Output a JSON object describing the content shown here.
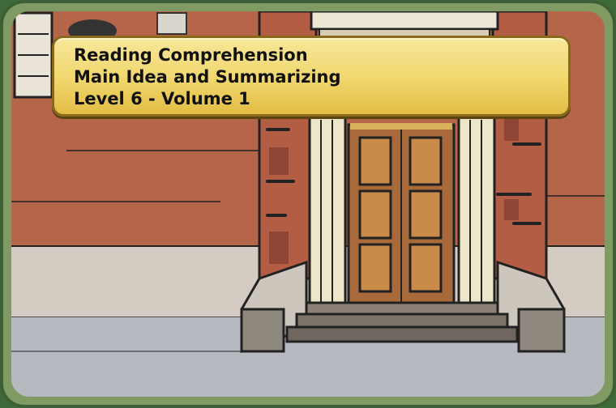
{
  "banner": {
    "lines": [
      "Reading Comprehension",
      "Main Idea and Summarizing",
      "Level 6 - Volume 1"
    ]
  },
  "scene": {
    "description_colors": {
      "frame": "#7f9a63",
      "wall": "#b5654a",
      "door": "#a86a3a",
      "banner": "#f0d66c",
      "sidewalk": "#b8bcc2"
    }
  }
}
